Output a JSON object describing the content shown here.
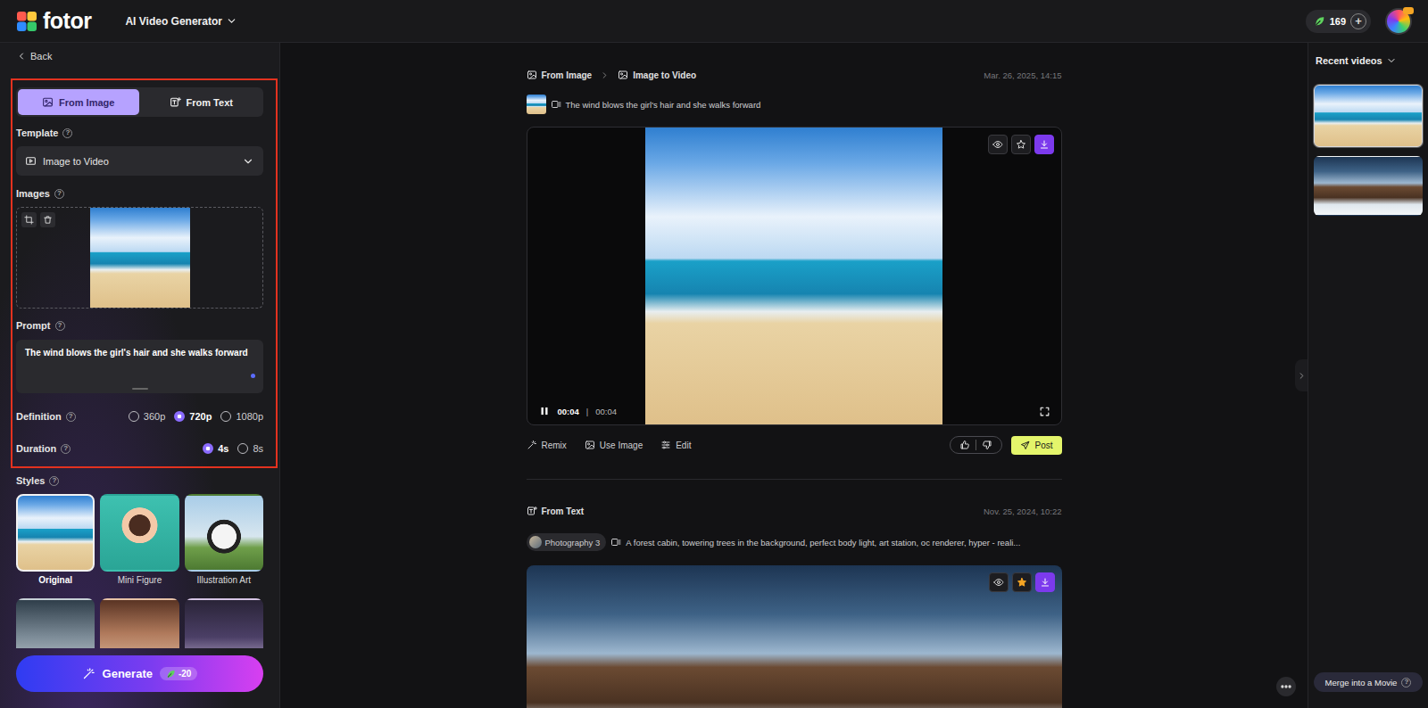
{
  "topbar": {
    "logo": "fotor",
    "tool": "AI Video Generator",
    "credits": "169",
    "add": "+"
  },
  "help": "?",
  "sidebar": {
    "back": "Back",
    "tabs": [
      {
        "label": "From Image",
        "selected": true
      },
      {
        "label": "From Text",
        "selected": false
      }
    ],
    "template": {
      "label": "Template",
      "value": "Image to Video"
    },
    "images": {
      "label": "Images"
    },
    "prompt": {
      "label": "Prompt",
      "value": "The wind blows the girl's hair and she walks forward"
    },
    "definition": {
      "label": "Definition",
      "options": [
        {
          "label": "360p",
          "selected": false
        },
        {
          "label": "720p",
          "selected": true
        },
        {
          "label": "1080p",
          "selected": false
        }
      ]
    },
    "duration": {
      "label": "Duration",
      "options": [
        {
          "label": "4s",
          "selected": true
        },
        {
          "label": "8s",
          "selected": false
        }
      ]
    },
    "styles": {
      "label": "Styles",
      "items": [
        {
          "label": "Original",
          "selected": true
        },
        {
          "label": "Mini Figure",
          "selected": false
        },
        {
          "label": "Illustration Art",
          "selected": false
        },
        {
          "selected": false
        },
        {
          "selected": false
        },
        {
          "selected": false
        }
      ]
    },
    "generate": {
      "label": "Generate",
      "cost": "-20"
    }
  },
  "feed": [
    {
      "source": "From Image",
      "crumb": "Image to Video",
      "date": "Mar. 26, 2025, 14:15",
      "prompt": "The wind blows the girl's hair and she walks forward",
      "favorite": false,
      "playing": true,
      "time": "00:04",
      "sep": "|",
      "total": "00:04",
      "actions": [
        "Remix",
        "Use Image",
        "Edit"
      ],
      "post": "Post"
    },
    {
      "source": "From Text",
      "date": "Nov. 25, 2024, 10:22",
      "style": "Photography 3",
      "prompt": "A forest cabin, towering trees in the background, perfect body light, art station, oc renderer, hyper - reali...",
      "favorite": true
    }
  ],
  "recent": {
    "title": "Recent videos",
    "items": [
      {
        "selected": true
      },
      {
        "selected": false
      }
    ]
  },
  "merge": {
    "label": "Merge into a Movie"
  }
}
